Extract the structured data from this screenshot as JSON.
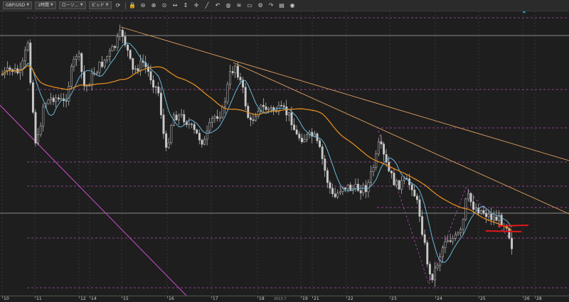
{
  "toolbar": {
    "symbol": "GBP/USD",
    "timeframe": "1時間",
    "chart_type": "ローソ…",
    "price_type": "ビッド",
    "icons": [
      "refresh-icon",
      "zoom-out-icon",
      "zoom-in-icon",
      "zoom-fit-icon",
      "fit-horizontal-icon",
      "fit-vertical-icon",
      "crosshair-icon",
      "line-tool-icon",
      "undo-icon",
      "indicator-icon",
      "template-icon",
      "window-icon",
      "settings-icon",
      "redo-icon",
      "save-icon",
      "camera-icon"
    ]
  },
  "x_axis": {
    "labels": [
      "10",
      "11",
      "12",
      "14",
      "15",
      "16",
      "17",
      "18",
      "19",
      "21",
      "22",
      "23",
      "24",
      "25",
      "26",
      "28"
    ],
    "month_label": "2013.7"
  },
  "colors": {
    "background": "#1e1e1e",
    "candle": "#c9c9c9",
    "ma_short": "#6ab7d9",
    "ma_long": "#e08a1e",
    "trendline": "#e0a060",
    "magenta_line": "#d14fd1",
    "grid_dashed": "#b04cb0",
    "red_marker": "#e01818",
    "horizontal_line": "#8a8a8a"
  }
}
